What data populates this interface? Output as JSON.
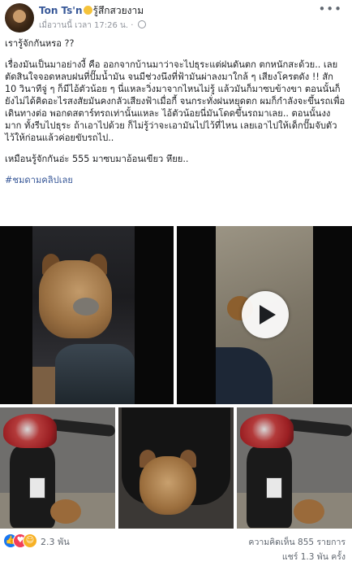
{
  "post": {
    "author": "Ton Ts'n",
    "feeling": "รู้สึกสวยงาม",
    "timestamp": "เมื่อวานนี้ เวลา 17:26 น.",
    "paragraphs": [
      "เรารู้จักกันหรอ ??",
      "เรื่องมันเป็นมาอย่างงี้ คือ ออกจากบ้านมาว่าจะไปธุระแต่ฝนดันตก ตกหนักสะด้วย.. เลยตัดสินใจจอดหลบฝนที่ปั๊มน้ำมัน จนมีช่วงนึงที่ฟ้ามันผ่าลงมาใกล้ ๆ เสียงโครตดัง !! สัก 10 วินาทีจู่ ๆ ก็มีไอ้ตัวน้อย ๆ นี่แหละวิ่งมาจากไหนไม่รู้ แล้วมันก็มาซบข้างขา ตอนนั้นก็ยังไม่ได้คิดอะไรสงสัยมันคงกลัวเสียงฟ้าเมื่อกี้ จนกระทั่งฝนหยุดตก ผมก็กำลังจะขึ้นรถเพื่อเดินทางต่อ พอกดสตาร์ทรถเท่านั้นแหละ ไอ้ตัวน้อยนี่มันโดดขึ้นรถมาเลย.. ตอนนั้นงงมาก ทั้งรีบไปธุระ ถ้าเอาไปด้วย ก็ไม่รู้ว่าจะเอามันไปไว้ที่ไหน เลยเอาไปให้เด็กปั๊มจับตัวไว้ให้ก่อนแล้วค่อยขับรถไป..",
      "เหมือนรู้จักกันอ่ะ 555 มาซบมาอ้อนเขียว หึยย.."
    ],
    "hashtag": "#ชมดามคลิปเลย"
  },
  "footer": {
    "reactions": "2.3 พัน",
    "comments": "ความคิดเห็น 855 รายการ",
    "shares": "แชร์ 1.3 พัน ครั้ง"
  }
}
